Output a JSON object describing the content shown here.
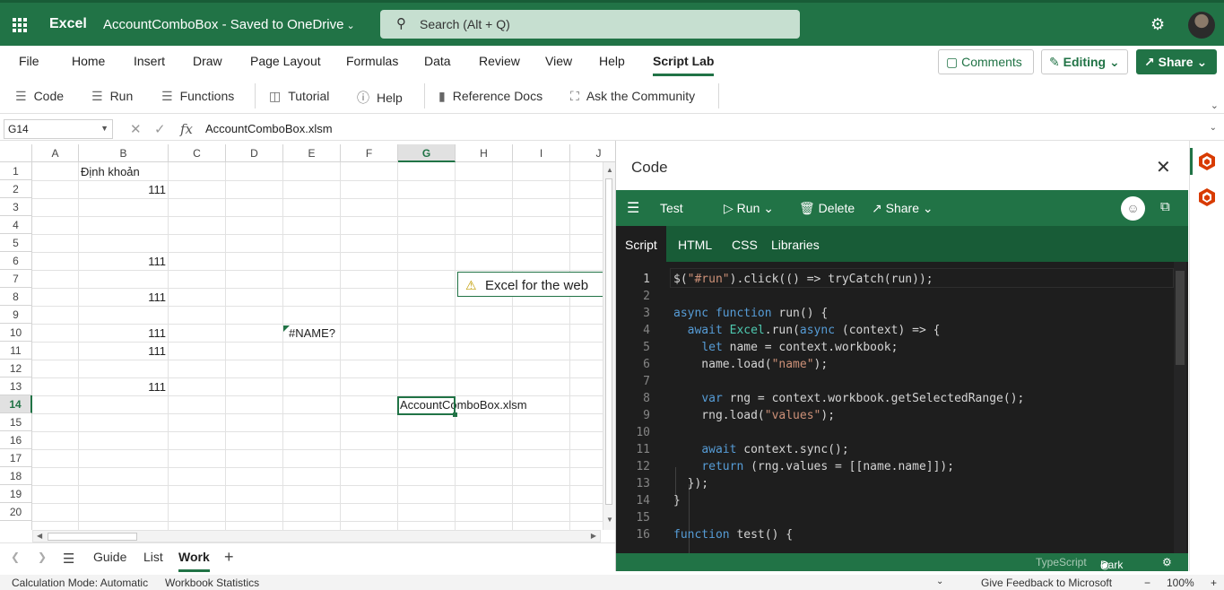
{
  "titlebar": {
    "app_name": "Excel",
    "doc_name": "AccountComboBox",
    "save_status": "Saved to OneDrive",
    "separator": " - ",
    "search_placeholder": "Search (Alt + Q)"
  },
  "menu": {
    "tabs": [
      "File",
      "Home",
      "Insert",
      "Draw",
      "Page Layout",
      "Formulas",
      "Data",
      "Review",
      "View",
      "Help",
      "Script Lab"
    ],
    "active": "Script Lab",
    "comments_label": "Comments",
    "editing_label": "Editing",
    "share_label": "Share"
  },
  "ribbon": {
    "items": [
      {
        "label": "Code",
        "icon": "code-icon"
      },
      {
        "label": "Run",
        "icon": "run-icon"
      },
      {
        "label": "Functions",
        "icon": "functions-icon"
      },
      {
        "label": "Tutorial",
        "icon": "tutorial-icon"
      },
      {
        "label": "Help",
        "icon": "help-icon"
      },
      {
        "label": "Reference Docs",
        "icon": "book-icon"
      },
      {
        "label": "Ask the Community",
        "icon": "community-icon"
      }
    ]
  },
  "formula_bar": {
    "name_box": "G14",
    "fx": "fx",
    "value": "AccountComboBox.xlsm"
  },
  "grid": {
    "columns": [
      "A",
      "B",
      "C",
      "D",
      "E",
      "F",
      "G",
      "H",
      "I",
      "J"
    ],
    "selected_column": "G",
    "rows": [
      "1",
      "2",
      "3",
      "4",
      "5",
      "6",
      "7",
      "8",
      "9",
      "10",
      "11",
      "12",
      "13",
      "14",
      "15",
      "16",
      "17",
      "18",
      "19",
      "20"
    ],
    "selected_row": "14",
    "cells": {
      "B1": "Định khoản",
      "B2": "111",
      "B6": "111",
      "B8": "111",
      "B10": "111",
      "B11": "111",
      "B13": "111",
      "E10": "#NAME?",
      "G14": "AccountComboBox.xlsm"
    },
    "callout_text": "Excel for the web"
  },
  "sheets": {
    "tabs": [
      "Guide",
      "List",
      "Work"
    ],
    "active": "Work"
  },
  "statusbar": {
    "calc_mode": "Calculation Mode: Automatic",
    "stats": "Workbook Statistics",
    "feedback": "Give Feedback to Microsoft",
    "zoom": "100%",
    "minus": "−",
    "plus": "+"
  },
  "code_pane": {
    "title": "Code",
    "snippet_name": "Test",
    "run_label": "Run",
    "delete_label": "Delete",
    "share_label": "Share",
    "tabs": [
      "Script",
      "HTML",
      "CSS",
      "Libraries"
    ],
    "active_tab": "Script",
    "line_numbers": [
      "1",
      "2",
      "3",
      "4",
      "5",
      "6",
      "7",
      "8",
      "9",
      "10",
      "11",
      "12",
      "13",
      "14",
      "15",
      "16"
    ],
    "footer_language": "TypeScript",
    "footer_theme": "Dark"
  },
  "colors": {
    "excel_green": "#217346",
    "dark_green": "#185c37",
    "editor_bg": "#1e1e1e"
  }
}
